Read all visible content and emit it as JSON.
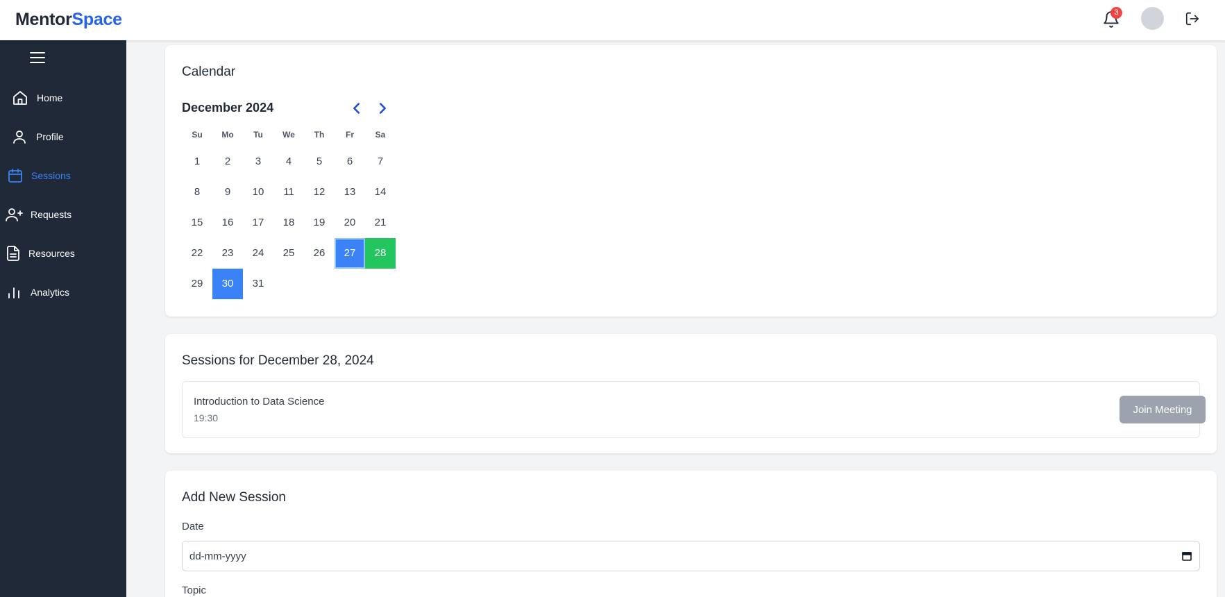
{
  "app": {
    "logo_part1": "Mentor",
    "logo_part2": "Space"
  },
  "header": {
    "notification_count": "3"
  },
  "sidebar": {
    "items": [
      {
        "label": "Home",
        "icon": "home-icon"
      },
      {
        "label": "Profile",
        "icon": "user-icon"
      },
      {
        "label": "Sessions",
        "icon": "calendar-icon",
        "active": true
      },
      {
        "label": "Requests",
        "icon": "user-plus-icon"
      },
      {
        "label": "Resources",
        "icon": "document-icon"
      },
      {
        "label": "Analytics",
        "icon": "bar-chart-icon"
      }
    ]
  },
  "calendar": {
    "title": "Calendar",
    "month_label": "December 2024",
    "weekdays": [
      "Su",
      "Mo",
      "Tu",
      "We",
      "Th",
      "Fr",
      "Sa"
    ],
    "first_weekday_index": 0,
    "days_in_month": 31,
    "highlighted_days_blue": [
      27,
      30
    ],
    "selected_day_green": 28,
    "colors": {
      "blue": "#3b82f6",
      "green": "#22c55e",
      "arrow": "#1d4ed8"
    }
  },
  "sessions": {
    "title": "Sessions for December 28, 2024",
    "items": [
      {
        "topic": "Introduction to Data Science",
        "time": "19:30",
        "button_label": "Join Meeting"
      }
    ]
  },
  "add_session": {
    "title": "Add New Session",
    "date_label": "Date",
    "date_placeholder": "dd-mm-yyyy",
    "topic_label": "Topic"
  }
}
